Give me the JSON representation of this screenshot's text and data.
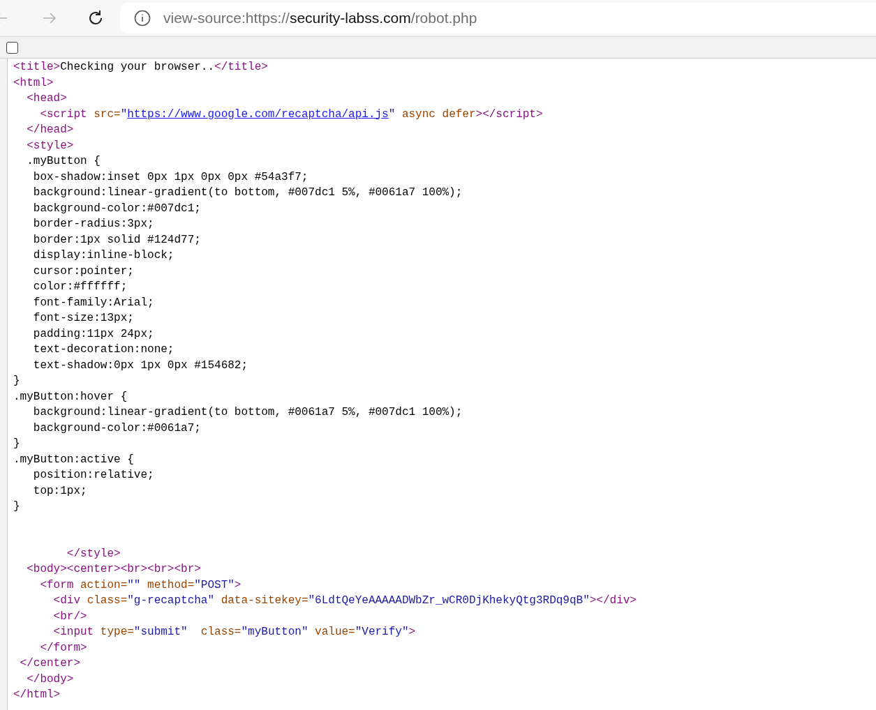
{
  "toolbar": {
    "back": {
      "disabled": true
    },
    "forward": {
      "disabled": true
    },
    "address": {
      "prefix": "view-source:https://",
      "host": "security-labss.com",
      "path": "/robot.php"
    }
  },
  "line_wrap": {
    "checked": false
  },
  "lines": [
    [
      {
        "kind": "tag",
        "text": "<title>"
      },
      {
        "kind": "text",
        "text": "Checking your browser.."
      },
      {
        "kind": "tag",
        "text": "</title>"
      }
    ],
    [
      {
        "kind": "tag",
        "text": "<html>"
      }
    ],
    [
      {
        "kind": "tag",
        "text": "  <head>"
      }
    ],
    [
      {
        "kind": "tag",
        "text": "    <script "
      },
      {
        "kind": "attr",
        "text": "src="
      },
      {
        "kind": "value",
        "text": "\""
      },
      {
        "kind": "link",
        "text": "https://www.google.com/recaptcha/api.js"
      },
      {
        "kind": "value",
        "text": "\""
      },
      {
        "kind": "attr",
        "text": " async defer"
      },
      {
        "kind": "tag",
        "text": "></script>"
      }
    ],
    [
      {
        "kind": "tag",
        "text": "  </head>"
      }
    ],
    [
      {
        "kind": "tag",
        "text": "  <style>"
      }
    ],
    [
      {
        "kind": "text",
        "text": "  .myButton {"
      }
    ],
    [
      {
        "kind": "text",
        "text": "   box-shadow:inset 0px 1px 0px 0px #54a3f7;"
      }
    ],
    [
      {
        "kind": "text",
        "text": "   background:linear-gradient(to bottom, #007dc1 5%, #0061a7 100%);"
      }
    ],
    [
      {
        "kind": "text",
        "text": "   background-color:#007dc1;"
      }
    ],
    [
      {
        "kind": "text",
        "text": "   border-radius:3px;"
      }
    ],
    [
      {
        "kind": "text",
        "text": "   border:1px solid #124d77;"
      }
    ],
    [
      {
        "kind": "text",
        "text": "   display:inline-block;"
      }
    ],
    [
      {
        "kind": "text",
        "text": "   cursor:pointer;"
      }
    ],
    [
      {
        "kind": "text",
        "text": "   color:#ffffff;"
      }
    ],
    [
      {
        "kind": "text",
        "text": "   font-family:Arial;"
      }
    ],
    [
      {
        "kind": "text",
        "text": "   font-size:13px;"
      }
    ],
    [
      {
        "kind": "text",
        "text": "   padding:11px 24px;"
      }
    ],
    [
      {
        "kind": "text",
        "text": "   text-decoration:none;"
      }
    ],
    [
      {
        "kind": "text",
        "text": "   text-shadow:0px 1px 0px #154682;"
      }
    ],
    [
      {
        "kind": "text",
        "text": "}"
      }
    ],
    [
      {
        "kind": "text",
        "text": ".myButton:hover {"
      }
    ],
    [
      {
        "kind": "text",
        "text": "   background:linear-gradient(to bottom, #0061a7 5%, #007dc1 100%);"
      }
    ],
    [
      {
        "kind": "text",
        "text": "   background-color:#0061a7;"
      }
    ],
    [
      {
        "kind": "text",
        "text": "}"
      }
    ],
    [
      {
        "kind": "text",
        "text": ".myButton:active {"
      }
    ],
    [
      {
        "kind": "text",
        "text": "   position:relative;"
      }
    ],
    [
      {
        "kind": "text",
        "text": "   top:1px;"
      }
    ],
    [
      {
        "kind": "text",
        "text": "}"
      }
    ],
    {
      "gap_before": true,
      "segments": [
        {
          "kind": "tag",
          "text": "        </style>"
        }
      ]
    },
    [
      {
        "kind": "tag",
        "text": "  <body><center><br><br><br>"
      }
    ],
    [
      {
        "kind": "tag",
        "text": "    <form "
      },
      {
        "kind": "attr",
        "text": "action="
      },
      {
        "kind": "value",
        "text": "\"\""
      },
      {
        "kind": "attr",
        "text": " method="
      },
      {
        "kind": "value",
        "text": "\"POST\""
      },
      {
        "kind": "tag",
        "text": ">"
      }
    ],
    [
      {
        "kind": "tag",
        "text": "      <div "
      },
      {
        "kind": "attr",
        "text": "class="
      },
      {
        "kind": "value",
        "text": "\"g-recaptcha\""
      },
      {
        "kind": "attr",
        "text": " data-sitekey="
      },
      {
        "kind": "value",
        "text": "\"6LdtQeYeAAAAADWbZr_wCR0DjKhekyQtg3RDq9qB\""
      },
      {
        "kind": "tag",
        "text": "></div>"
      }
    ],
    [
      {
        "kind": "tag",
        "text": "      <br/>"
      }
    ],
    [
      {
        "kind": "tag",
        "text": "      <input "
      },
      {
        "kind": "attr",
        "text": "type="
      },
      {
        "kind": "value",
        "text": "\"submit\""
      },
      {
        "kind": "attr",
        "text": "  class="
      },
      {
        "kind": "value",
        "text": "\"myButton\""
      },
      {
        "kind": "attr",
        "text": " value="
      },
      {
        "kind": "value",
        "text": "\"Verify\""
      },
      {
        "kind": "tag",
        "text": ">"
      }
    ],
    [
      {
        "kind": "tag",
        "text": "    </form>"
      }
    ],
    [
      {
        "kind": "tag",
        "text": " </center>"
      }
    ],
    [
      {
        "kind": "tag",
        "text": "  </body>"
      }
    ],
    [
      {
        "kind": "tag",
        "text": "</html>"
      }
    ]
  ]
}
